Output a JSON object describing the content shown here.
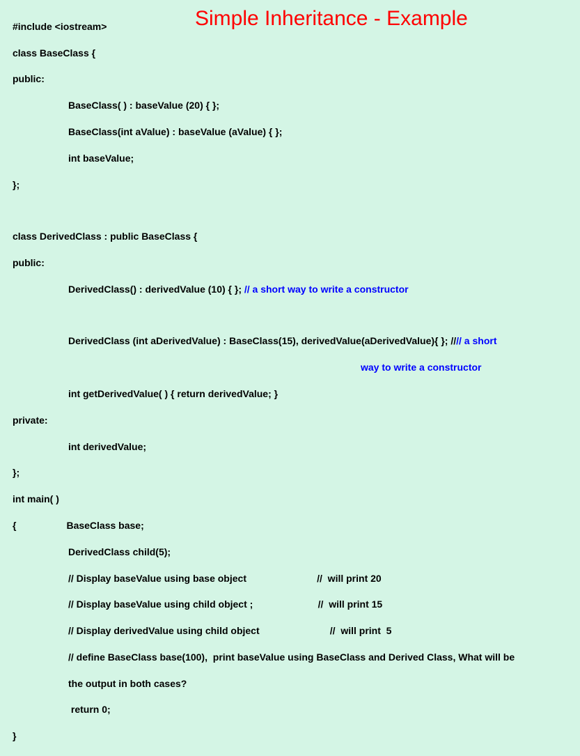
{
  "title": "Simple Inheritance - Example",
  "code": {
    "l1": "#include <iostream>",
    "l2": "class BaseClass {",
    "l3": "public:",
    "l4": "BaseClass( ) : baseValue (20) { };",
    "l5": "BaseClass(int aValue) : baseValue (aValue) { };",
    "l6": "int baseValue;",
    "l7": "};",
    "l8": "class DerivedClass : public BaseClass {",
    "l9": "public:",
    "l10a": "DerivedClass() : derivedValue (10) { }; ",
    "l10b": "// a short way to write a constructor",
    "l11a": "DerivedClass (int aDerivedValue) : BaseClass(15), derivedValue(aDerivedValue){ }; //",
    "l11b": "// a short",
    "l11c": "way to write a constructor",
    "l12": "int getDerivedValue( ) { return derivedValue; }",
    "l13": "private:",
    "l14": "int derivedValue;",
    "l15": "};",
    "l16": "int main( )",
    "l17a": "{",
    "l17b": "BaseClass base;",
    "l18": "DerivedClass child(5);",
    "l19": "// Display baseValue using base object                          //  will print 20",
    "l20": "// Display baseValue using child object ;                        //  will print 15",
    "l21": "// Display derivedValue using child object                          //  will print  5",
    "l22": "// define BaseClass base(100),  print baseValue using BaseClass and Derived Class, What will be",
    "l22b": "the output in both cases?",
    "l23": " return 0;",
    "l24": "}"
  }
}
